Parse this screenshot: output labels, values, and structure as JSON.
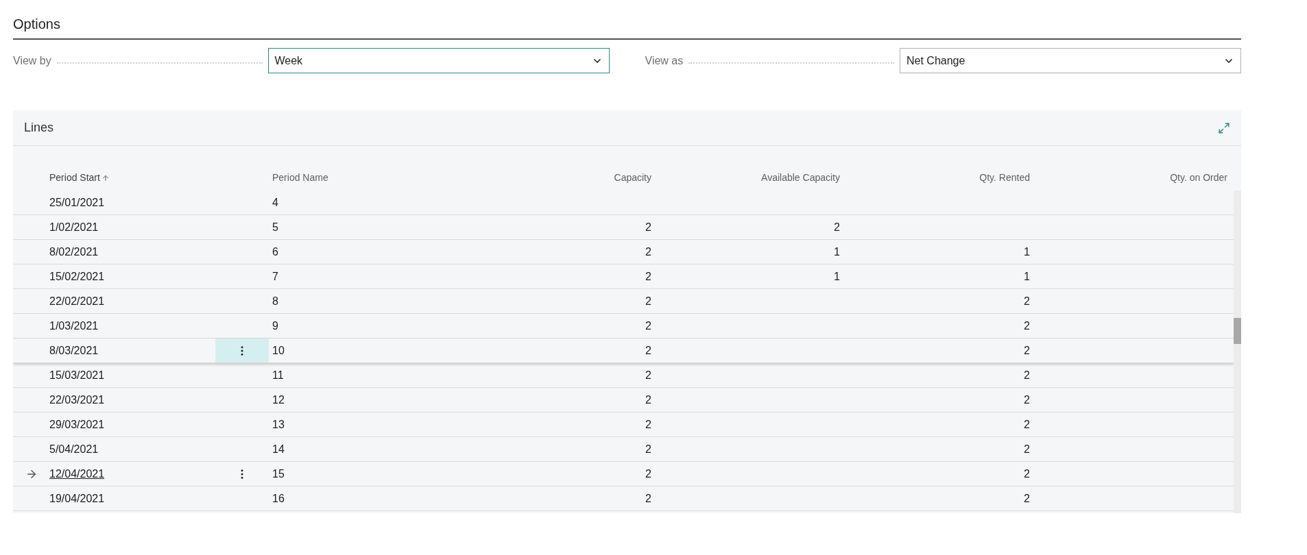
{
  "options": {
    "title": "Options",
    "fields": [
      {
        "label": "View by",
        "value": "Week"
      },
      {
        "label": "View as",
        "value": "Net Change"
      }
    ]
  },
  "lines": {
    "title": "Lines",
    "columns": [
      {
        "label": "Period Start",
        "sorted": true
      },
      {
        "label": "Period Name",
        "sorted": false
      },
      {
        "label": "Capacity",
        "sorted": false
      },
      {
        "label": "Available Capacity",
        "sorted": false
      },
      {
        "label": "Qty. Rented",
        "sorted": false
      },
      {
        "label": "Qty. on Order",
        "sorted": false
      }
    ],
    "rows": [
      {
        "period_start": "25/01/2021",
        "period_name": "4",
        "capacity": "",
        "available_capacity": "",
        "qty_rented": "",
        "selected": false,
        "current": false
      },
      {
        "period_start": "1/02/2021",
        "period_name": "5",
        "capacity": "2",
        "available_capacity": "2",
        "qty_rented": "",
        "selected": false,
        "current": false
      },
      {
        "period_start": "8/02/2021",
        "period_name": "6",
        "capacity": "2",
        "available_capacity": "1",
        "qty_rented": "1",
        "selected": false,
        "current": false
      },
      {
        "period_start": "15/02/2021",
        "period_name": "7",
        "capacity": "2",
        "available_capacity": "1",
        "qty_rented": "1",
        "selected": false,
        "current": false
      },
      {
        "period_start": "22/02/2021",
        "period_name": "8",
        "capacity": "2",
        "available_capacity": "",
        "qty_rented": "2",
        "selected": false,
        "current": false
      },
      {
        "period_start": "1/03/2021",
        "period_name": "9",
        "capacity": "2",
        "available_capacity": "",
        "qty_rented": "2",
        "selected": false,
        "current": false
      },
      {
        "period_start": "8/03/2021",
        "period_name": "10",
        "capacity": "2",
        "available_capacity": "",
        "qty_rented": "2",
        "selected": true,
        "current": false
      },
      {
        "period_start": "15/03/2021",
        "period_name": "11",
        "capacity": "2",
        "available_capacity": "",
        "qty_rented": "2",
        "selected": false,
        "current": false
      },
      {
        "period_start": "22/03/2021",
        "period_name": "12",
        "capacity": "2",
        "available_capacity": "",
        "qty_rented": "2",
        "selected": false,
        "current": false
      },
      {
        "period_start": "29/03/2021",
        "period_name": "13",
        "capacity": "2",
        "available_capacity": "",
        "qty_rented": "2",
        "selected": false,
        "current": false
      },
      {
        "period_start": "5/04/2021",
        "period_name": "14",
        "capacity": "2",
        "available_capacity": "",
        "qty_rented": "2",
        "selected": false,
        "current": false
      },
      {
        "period_start": "12/04/2021",
        "period_name": "15",
        "capacity": "2",
        "available_capacity": "",
        "qty_rented": "2",
        "selected": false,
        "current": true
      },
      {
        "period_start": "19/04/2021",
        "period_name": "16",
        "capacity": "2",
        "available_capacity": "",
        "qty_rented": "2",
        "selected": false,
        "current": false
      }
    ]
  }
}
